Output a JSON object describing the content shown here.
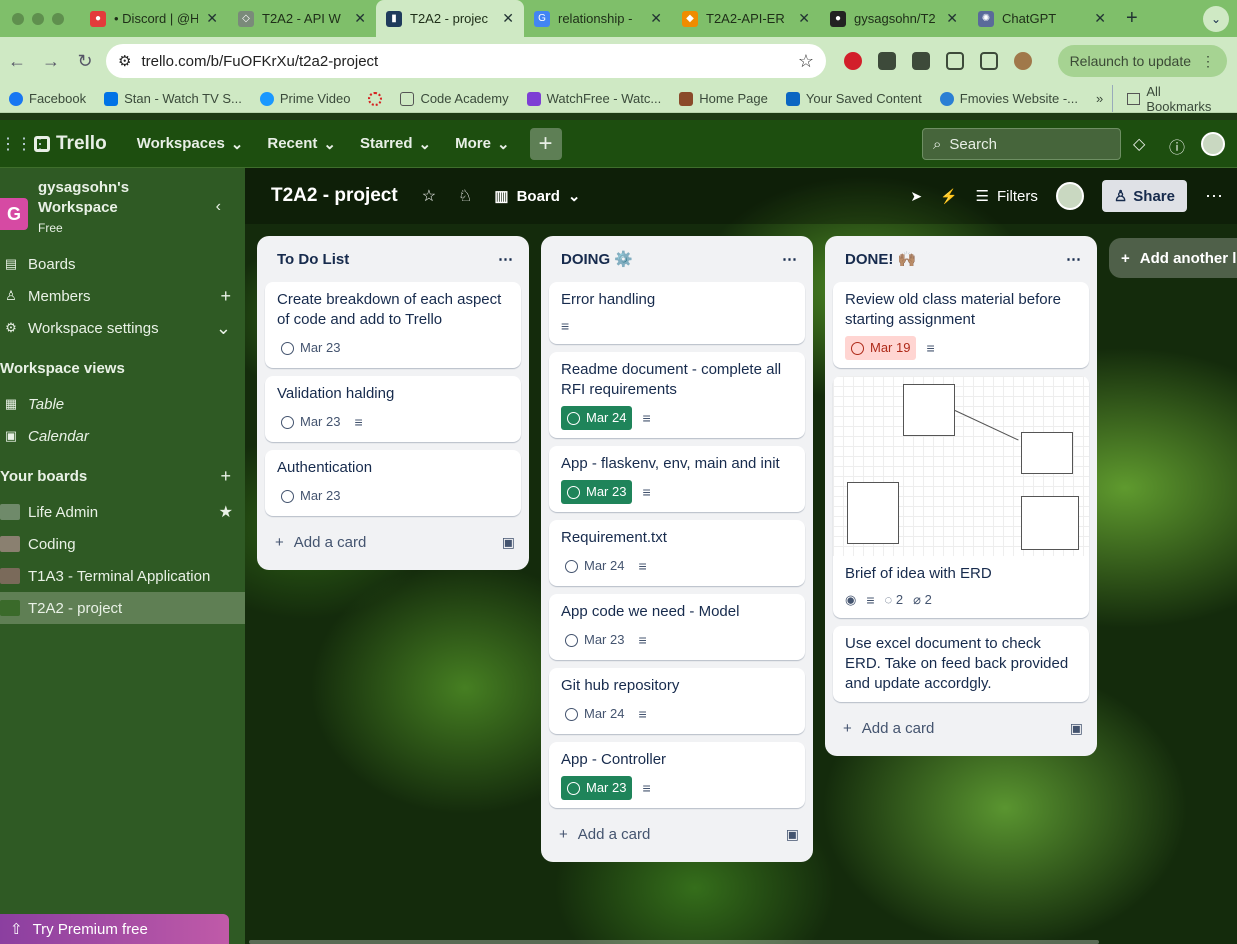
{
  "browser": {
    "tabs": [
      {
        "title": "• Discord | @H",
        "color": "#e33b3b"
      },
      {
        "title": "T2A2 - API W",
        "color": "#7a8a7a"
      },
      {
        "title": "T2A2 - projec",
        "color": "#1f3b5c"
      },
      {
        "title": "relationship -",
        "color": "#4285f4"
      },
      {
        "title": "T2A2-API-ER",
        "color": "#f08c00"
      },
      {
        "title": "gysagsohn/T2",
        "color": "#222222"
      },
      {
        "title": "ChatGPT",
        "color": "#5a6a9a"
      }
    ],
    "url": "trello.com/b/FuOFKrXu/t2a2-project",
    "relaunch": "Relaunch to update",
    "bookmarks": [
      {
        "label": "Facebook",
        "color": "#1877f2"
      },
      {
        "label": "Stan - Watch TV S...",
        "color": "#0073e6"
      },
      {
        "label": "Prime Video",
        "color": "#1a98ff"
      },
      {
        "label": "",
        "color": "#d62020"
      },
      {
        "label": "Code Academy",
        "color": "#6a6a6a"
      },
      {
        "label": "WatchFree - Watc...",
        "color": "#7d3fd4"
      },
      {
        "label": "Home Page",
        "color": "#8a4a2a"
      },
      {
        "label": "Your Saved Content",
        "color": "#0a66c2"
      },
      {
        "label": "Fmovies Website -...",
        "color": "#2a7fd4"
      }
    ],
    "all_bookmarks": "All Bookmarks"
  },
  "nav": {
    "logo": "Trello",
    "menus": [
      "Workspaces",
      "Recent",
      "Starred",
      "More"
    ],
    "search_placeholder": "Search"
  },
  "sidebar": {
    "workspace_initial": "G",
    "workspace_name": "gysagsohn's Workspace",
    "plan": "Free",
    "items": [
      "Boards",
      "Members",
      "Workspace settings"
    ],
    "views_header": "Workspace views",
    "views": [
      "Table",
      "Calendar"
    ],
    "boards_header": "Your boards",
    "boards": [
      {
        "name": "Life Admin",
        "color": "#6f8a6a"
      },
      {
        "name": "Coding",
        "color": "#8a8070"
      },
      {
        "name": "T1A3 - Terminal Application",
        "color": "#7a6a5a"
      },
      {
        "name": "T2A2 - project",
        "color": "#3a6a2a"
      }
    ],
    "premium": "Try Premium free"
  },
  "board": {
    "title": "T2A2 - project",
    "view": "Board",
    "filters": "Filters",
    "share": "Share",
    "add_list": "Add another li",
    "add_card": "Add a card"
  },
  "lists": [
    {
      "title": "To Do List",
      "cards": [
        {
          "title": "Create breakdown of each aspect of code and add to Trello",
          "due": "Mar 23"
        },
        {
          "title": "Validation halding",
          "due": "Mar 23"
        },
        {
          "title": "Authentication",
          "due": "Mar 23"
        }
      ]
    },
    {
      "title": "DOING ⚙️",
      "cards": [
        {
          "title": "Error handling"
        },
        {
          "title": "Readme document - complete all RFI requirements",
          "due": "Mar 24"
        },
        {
          "title": "App - flaskenv, env, main and init",
          "due": "Mar 23"
        },
        {
          "title": "Requirement.txt",
          "due": "Mar 24"
        },
        {
          "title": "App code we need - Model",
          "due": "Mar 23"
        },
        {
          "title": "Git hub repository",
          "due": "Mar 24"
        },
        {
          "title": "App - Controller",
          "due": "Mar 23"
        }
      ]
    },
    {
      "title": "DONE! 🙌🏽",
      "cards": [
        {
          "title": "Review old class material before starting assignment",
          "due": "Mar 19"
        },
        {
          "title": "Brief of idea with ERD",
          "comments": "2",
          "attachments": "2"
        },
        {
          "title": "Use excel document to check ERD. Take on feed back provided and update accordgly."
        }
      ]
    }
  ]
}
